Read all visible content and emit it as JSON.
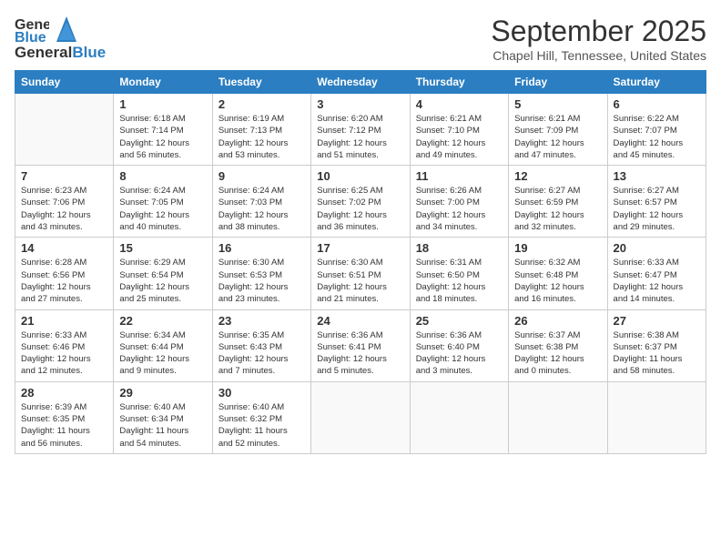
{
  "logo": {
    "general": "General",
    "blue": "Blue"
  },
  "title": "September 2025",
  "location": "Chapel Hill, Tennessee, United States",
  "days_header": [
    "Sunday",
    "Monday",
    "Tuesday",
    "Wednesday",
    "Thursday",
    "Friday",
    "Saturday"
  ],
  "weeks": [
    [
      {
        "day": "",
        "info": ""
      },
      {
        "day": "1",
        "info": "Sunrise: 6:18 AM\nSunset: 7:14 PM\nDaylight: 12 hours\nand 56 minutes."
      },
      {
        "day": "2",
        "info": "Sunrise: 6:19 AM\nSunset: 7:13 PM\nDaylight: 12 hours\nand 53 minutes."
      },
      {
        "day": "3",
        "info": "Sunrise: 6:20 AM\nSunset: 7:12 PM\nDaylight: 12 hours\nand 51 minutes."
      },
      {
        "day": "4",
        "info": "Sunrise: 6:21 AM\nSunset: 7:10 PM\nDaylight: 12 hours\nand 49 minutes."
      },
      {
        "day": "5",
        "info": "Sunrise: 6:21 AM\nSunset: 7:09 PM\nDaylight: 12 hours\nand 47 minutes."
      },
      {
        "day": "6",
        "info": "Sunrise: 6:22 AM\nSunset: 7:07 PM\nDaylight: 12 hours\nand 45 minutes."
      }
    ],
    [
      {
        "day": "7",
        "info": "Sunrise: 6:23 AM\nSunset: 7:06 PM\nDaylight: 12 hours\nand 43 minutes."
      },
      {
        "day": "8",
        "info": "Sunrise: 6:24 AM\nSunset: 7:05 PM\nDaylight: 12 hours\nand 40 minutes."
      },
      {
        "day": "9",
        "info": "Sunrise: 6:24 AM\nSunset: 7:03 PM\nDaylight: 12 hours\nand 38 minutes."
      },
      {
        "day": "10",
        "info": "Sunrise: 6:25 AM\nSunset: 7:02 PM\nDaylight: 12 hours\nand 36 minutes."
      },
      {
        "day": "11",
        "info": "Sunrise: 6:26 AM\nSunset: 7:00 PM\nDaylight: 12 hours\nand 34 minutes."
      },
      {
        "day": "12",
        "info": "Sunrise: 6:27 AM\nSunset: 6:59 PM\nDaylight: 12 hours\nand 32 minutes."
      },
      {
        "day": "13",
        "info": "Sunrise: 6:27 AM\nSunset: 6:57 PM\nDaylight: 12 hours\nand 29 minutes."
      }
    ],
    [
      {
        "day": "14",
        "info": "Sunrise: 6:28 AM\nSunset: 6:56 PM\nDaylight: 12 hours\nand 27 minutes."
      },
      {
        "day": "15",
        "info": "Sunrise: 6:29 AM\nSunset: 6:54 PM\nDaylight: 12 hours\nand 25 minutes."
      },
      {
        "day": "16",
        "info": "Sunrise: 6:30 AM\nSunset: 6:53 PM\nDaylight: 12 hours\nand 23 minutes."
      },
      {
        "day": "17",
        "info": "Sunrise: 6:30 AM\nSunset: 6:51 PM\nDaylight: 12 hours\nand 21 minutes."
      },
      {
        "day": "18",
        "info": "Sunrise: 6:31 AM\nSunset: 6:50 PM\nDaylight: 12 hours\nand 18 minutes."
      },
      {
        "day": "19",
        "info": "Sunrise: 6:32 AM\nSunset: 6:48 PM\nDaylight: 12 hours\nand 16 minutes."
      },
      {
        "day": "20",
        "info": "Sunrise: 6:33 AM\nSunset: 6:47 PM\nDaylight: 12 hours\nand 14 minutes."
      }
    ],
    [
      {
        "day": "21",
        "info": "Sunrise: 6:33 AM\nSunset: 6:46 PM\nDaylight: 12 hours\nand 12 minutes."
      },
      {
        "day": "22",
        "info": "Sunrise: 6:34 AM\nSunset: 6:44 PM\nDaylight: 12 hours\nand 9 minutes."
      },
      {
        "day": "23",
        "info": "Sunrise: 6:35 AM\nSunset: 6:43 PM\nDaylight: 12 hours\nand 7 minutes."
      },
      {
        "day": "24",
        "info": "Sunrise: 6:36 AM\nSunset: 6:41 PM\nDaylight: 12 hours\nand 5 minutes."
      },
      {
        "day": "25",
        "info": "Sunrise: 6:36 AM\nSunset: 6:40 PM\nDaylight: 12 hours\nand 3 minutes."
      },
      {
        "day": "26",
        "info": "Sunrise: 6:37 AM\nSunset: 6:38 PM\nDaylight: 12 hours\nand 0 minutes."
      },
      {
        "day": "27",
        "info": "Sunrise: 6:38 AM\nSunset: 6:37 PM\nDaylight: 11 hours\nand 58 minutes."
      }
    ],
    [
      {
        "day": "28",
        "info": "Sunrise: 6:39 AM\nSunset: 6:35 PM\nDaylight: 11 hours\nand 56 minutes."
      },
      {
        "day": "29",
        "info": "Sunrise: 6:40 AM\nSunset: 6:34 PM\nDaylight: 11 hours\nand 54 minutes."
      },
      {
        "day": "30",
        "info": "Sunrise: 6:40 AM\nSunset: 6:32 PM\nDaylight: 11 hours\nand 52 minutes."
      },
      {
        "day": "",
        "info": ""
      },
      {
        "day": "",
        "info": ""
      },
      {
        "day": "",
        "info": ""
      },
      {
        "day": "",
        "info": ""
      }
    ]
  ]
}
